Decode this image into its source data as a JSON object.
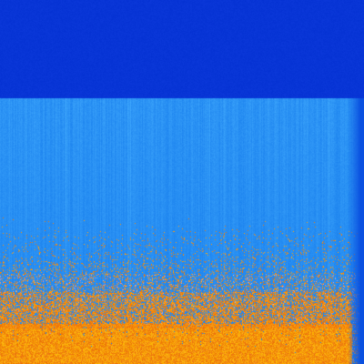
{
  "image": {
    "type": "spectrogram",
    "colors": {
      "top_band": "#0532d3",
      "mid_blue": "#1e88f4",
      "light_blue": "#38a8ff",
      "orange": "#ff8a00",
      "yellow_orange": "#ffb020",
      "right_edge": "#0a4fe0"
    }
  }
}
